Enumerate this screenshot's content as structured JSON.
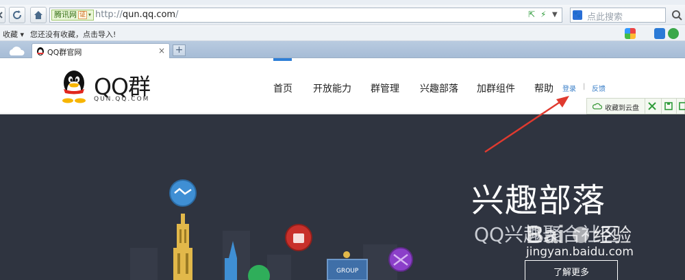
{
  "browser": {
    "title_fragment": "QQ群官网",
    "address": {
      "site_badge": "腾讯网",
      "site_cert": "证",
      "url_prefix": "http://",
      "url_domain": "qun.qq.com",
      "url_suffix": "/"
    },
    "search": {
      "placeholder": "点此搜索"
    },
    "favorites": {
      "label": "收藏",
      "tip": "您还没有收藏，点击导入!"
    },
    "tabs": [
      {
        "title": "QQ群官网",
        "close": "×"
      }
    ],
    "new_tab": "+"
  },
  "header": {
    "logo_title": "QQ群",
    "logo_sub": "QUN.QQ.COM",
    "nav": [
      {
        "label": "首页",
        "active": true
      },
      {
        "label": "开放能力"
      },
      {
        "label": "群管理"
      },
      {
        "label": "兴趣部落"
      },
      {
        "label": "加群组件"
      },
      {
        "label": "帮助"
      }
    ],
    "login": "登录",
    "separator": "|",
    "feedback": "反馈",
    "cloud_save": "收藏到云盘"
  },
  "hero": {
    "title": "兴趣部落",
    "subtitle": "QQ兴趣聚合社区",
    "button": "了解更多",
    "group_sign": "GROUP"
  },
  "watermark": {
    "text": "jingyan.baidu.com",
    "brand": "经验"
  },
  "colors": {
    "hero_bg": "#2f3440",
    "nav_active": "#2f7fd6",
    "link": "#3a7fc8",
    "annotation_arrow": "#e03a2f"
  }
}
